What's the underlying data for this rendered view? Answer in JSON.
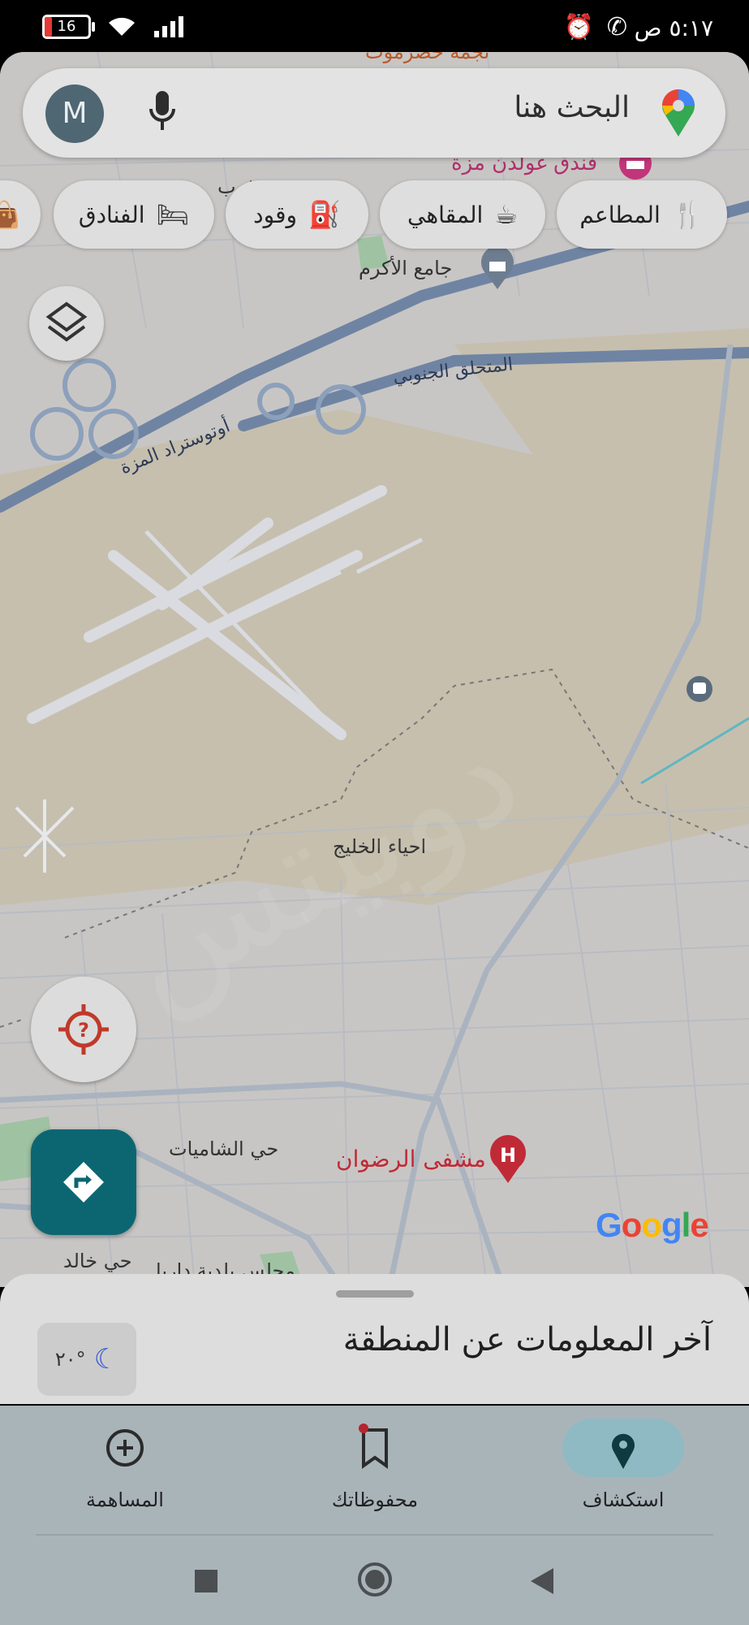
{
  "status_bar": {
    "time": "٥:١٧ ص",
    "battery": "16",
    "battery_fraction": 0.16
  },
  "search": {
    "placeholder": "البحث هنا",
    "avatar_initial": "M"
  },
  "chips": [
    {
      "label": "المطاعم",
      "icon": "fork-knife-icon"
    },
    {
      "label": "المقاهي",
      "icon": "coffee-icon"
    },
    {
      "label": "وقود",
      "icon": "fuel-icon"
    },
    {
      "label": "الفنادق",
      "icon": "bed-icon"
    }
  ],
  "map_labels": {
    "top_place": "نجمة حضرموت",
    "hotel": "فندق غولدن مزة",
    "west": "غرب",
    "mosque": "جامع الأكرم",
    "south_interchange": "المتحلق الجنوبي",
    "mezzeh_highway": "أوتوستراد المزة",
    "district": "احياء الخليج",
    "shamiyat": "حي الشاميات",
    "hospital": "مشفى الرضوان",
    "khaled": "حي خالد",
    "municipality": "مجلس بلدية داريا",
    "watermark": "دوبيتس"
  },
  "google_logo": {
    "letters": [
      "G",
      "o",
      "o",
      "g",
      "l",
      "e"
    ],
    "colors": [
      "#4285F4",
      "#EA4335",
      "#FBBC05",
      "#4285F4",
      "#34A853",
      "#EA4335"
    ]
  },
  "bottom_sheet": {
    "title": "آخر المعلومات عن المنطقة",
    "weather": "٢٠°"
  },
  "bottom_nav": [
    {
      "label": "استكشاف",
      "icon": "location-pin-icon",
      "active": true
    },
    {
      "label": "محفوظاتك",
      "icon": "bookmark-icon",
      "active": false
    },
    {
      "label": "المساهمة",
      "icon": "add-circle-icon",
      "active": false
    }
  ],
  "colors": {
    "accent_teal": "#0c6672",
    "hospital_red": "#c02a36",
    "hotel_pink": "#b0306c"
  }
}
